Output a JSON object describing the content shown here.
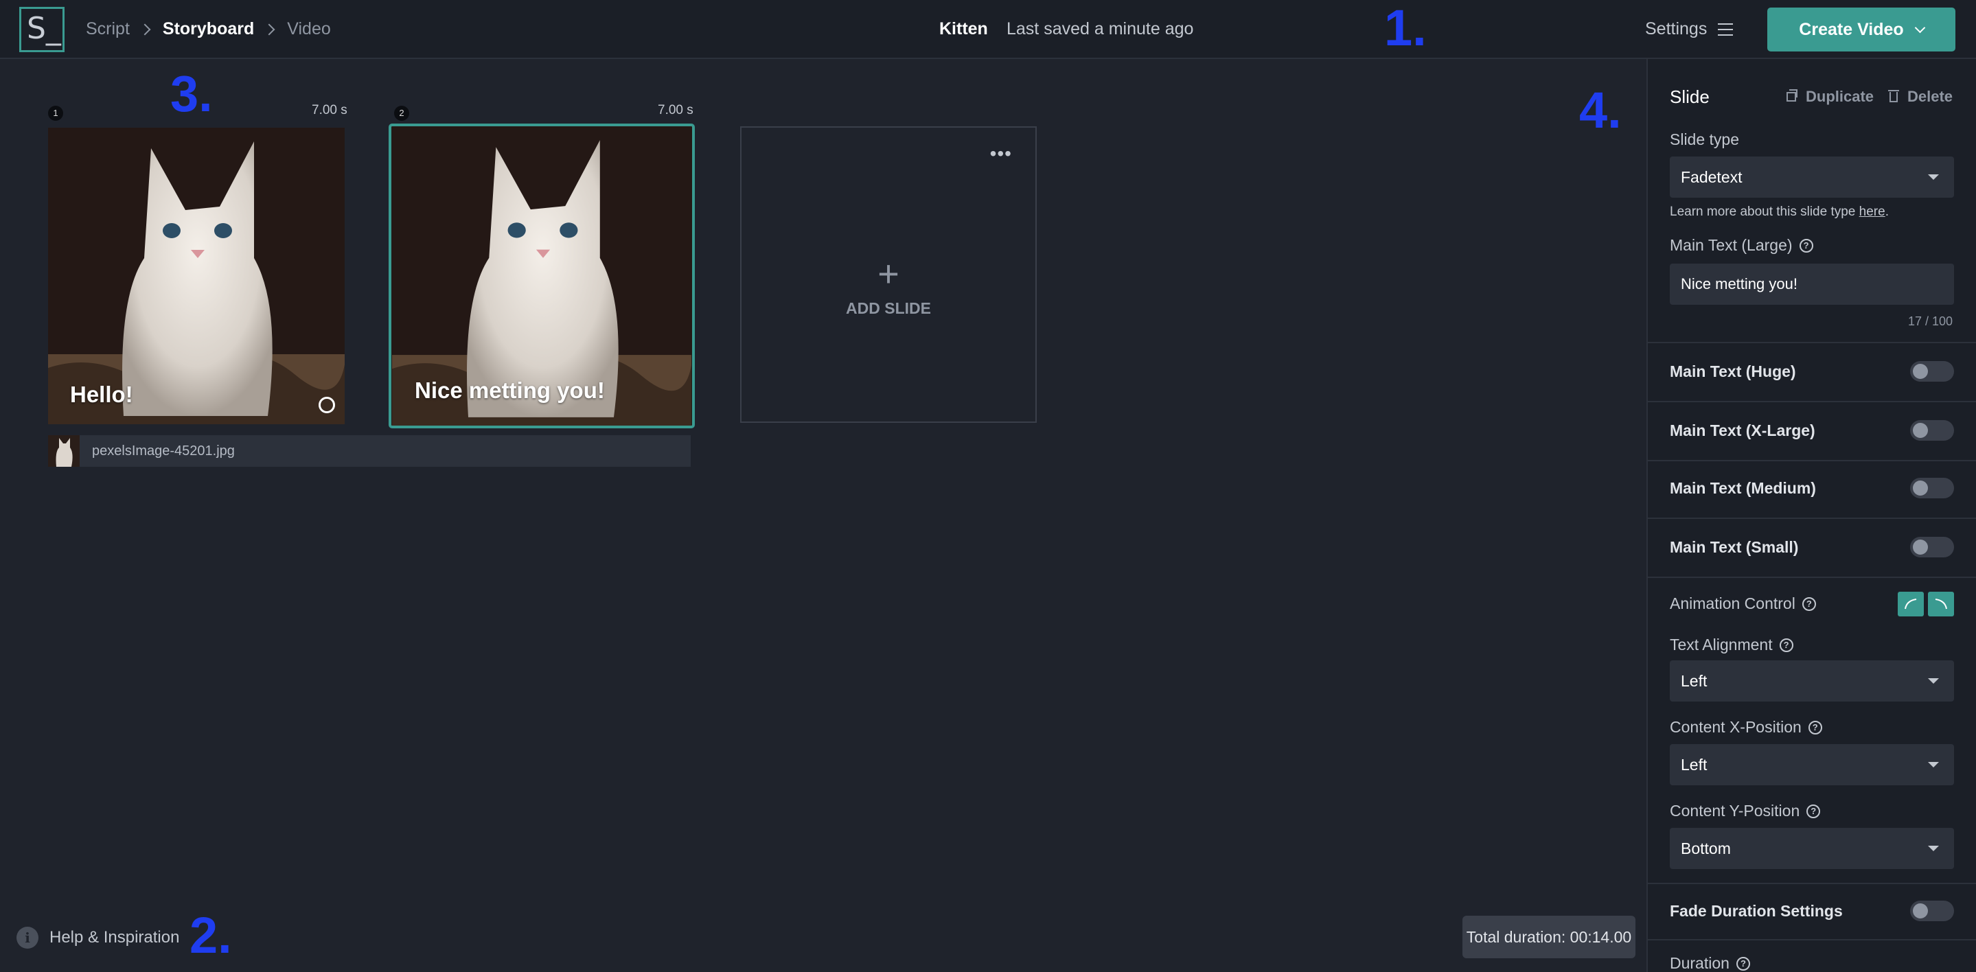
{
  "header": {
    "logo": "S_",
    "breadcrumbs": [
      "Script",
      "Storyboard",
      "Video"
    ],
    "project_title": "Kitten",
    "save_status": "Last saved a minute ago",
    "settings_label": "Settings",
    "create_button_label": "Create Video"
  },
  "annotations": [
    "1.",
    "2.",
    "3.",
    "4."
  ],
  "storyboard": {
    "slides": [
      {
        "number": "1",
        "duration": "7.00 s",
        "text": "Hello!"
      },
      {
        "number": "2",
        "duration": "7.00 s",
        "text": "Nice metting you!"
      }
    ],
    "add_slide_label": "ADD SLIDE",
    "more_label": "•••",
    "file_name": "pexelsImage-45201.jpg"
  },
  "footer": {
    "help_label": "Help & Inspiration",
    "total_duration": "Total duration: 00:14.00"
  },
  "panel": {
    "title": "Slide",
    "duplicate_label": "Duplicate",
    "delete_label": "Delete",
    "slide_type_label": "Slide type",
    "slide_type_value": "Fadetext",
    "learn_more_prefix": "Learn more about this slide type ",
    "learn_more_link": "here",
    "learn_more_suffix": ".",
    "main_text_large_label": "Main Text (Large)",
    "main_text_large_value": "Nice metting you!",
    "char_counter": "17 / 100",
    "toggles": [
      {
        "label": "Main Text (Huge)",
        "on": false
      },
      {
        "label": "Main Text (X-Large)",
        "on": false
      },
      {
        "label": "Main Text (Medium)",
        "on": false
      },
      {
        "label": "Main Text (Small)",
        "on": false
      }
    ],
    "animation_control_label": "Animation Control",
    "text_alignment_label": "Text Alignment",
    "text_alignment_value": "Left",
    "content_x_label": "Content X-Position",
    "content_x_value": "Left",
    "content_y_label": "Content Y-Position",
    "content_y_value": "Bottom",
    "fade_duration_label": "Fade Duration Settings",
    "duration_label": "Duration"
  },
  "colors": {
    "accent": "#3a9b91",
    "background": "#1f232c",
    "annotation": "#1f3df0"
  }
}
